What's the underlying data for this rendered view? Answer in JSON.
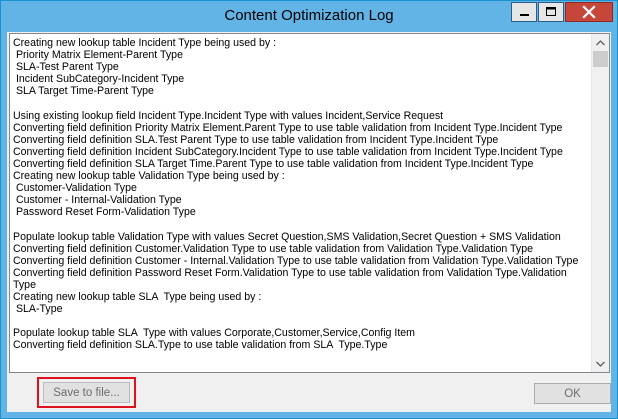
{
  "window": {
    "title": "Content Optimization Log"
  },
  "log": {
    "text": "Creating new lookup table Incident Type being used by :\n Priority Matrix Element-Parent Type\n SLA-Test Parent Type\n Incident SubCategory-Incident Type\n SLA Target Time-Parent Type\n\nUsing existing lookup field Incident Type.Incident Type with values Incident,Service Request\nConverting field definition Priority Matrix Element.Parent Type to use table validation from Incident Type.Incident Type\nConverting field definition SLA.Test Parent Type to use table validation from Incident Type.Incident Type\nConverting field definition Incident SubCategory.Incident Type to use table validation from Incident Type.Incident Type\nConverting field definition SLA Target Time.Parent Type to use table validation from Incident Type.Incident Type\nCreating new lookup table Validation Type being used by :\n Customer-Validation Type\n Customer - Internal-Validation Type\n Password Reset Form-Validation Type\n\nPopulate lookup table Validation Type with values Secret Question,SMS Validation,Secret Question + SMS Validation\nConverting field definition Customer.Validation Type to use table validation from Validation Type.Validation Type\nConverting field definition Customer - Internal.Validation Type to use table validation from Validation Type.Validation Type\nConverting field definition Password Reset Form.Validation Type to use table validation from Validation Type.Validation\nType\nCreating new lookup table SLA  Type being used by :\n SLA-Type\n\nPopulate lookup table SLA  Type with values Corporate,Customer,Service,Config Item\nConverting field definition SLA.Type to use table validation from SLA  Type.Type"
  },
  "buttons": {
    "save_label": "Save to file...",
    "ok_label": "OK"
  },
  "icons": {
    "minimize": "minimize-icon",
    "maximize": "maximize-icon",
    "close": "close-icon",
    "scroll_up": "chevron-up-icon",
    "scroll_down": "chevron-down-icon"
  },
  "colors": {
    "titlebar": "#62b4e6",
    "close_button": "#c7463a",
    "highlight": "#e0101e"
  }
}
